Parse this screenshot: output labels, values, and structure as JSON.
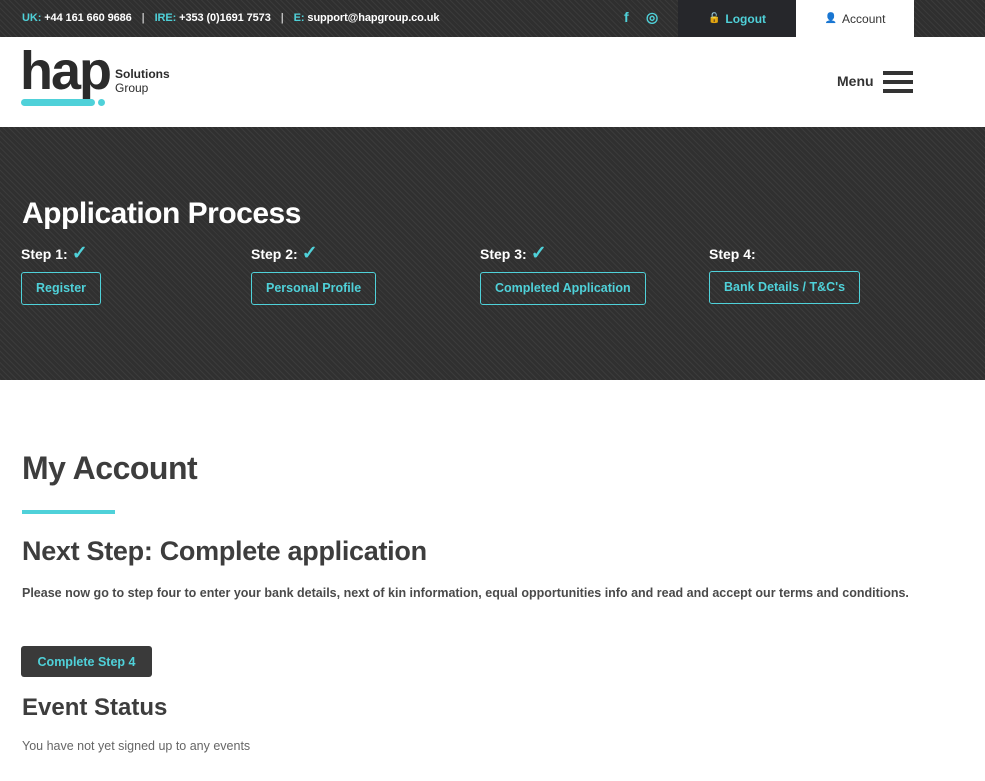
{
  "topbar": {
    "uk_label": "UK:",
    "uk_phone": "+44 161 660 9686",
    "ire_label": "IRE:",
    "ire_phone": "+353 (0)1691 7573",
    "email_label": "E:",
    "email": "support@hapgroup.co.uk",
    "separator": "|",
    "facebook_icon": "f",
    "instagram_icon": "◎",
    "logout_icon": "🔓",
    "logout_label": "Logout",
    "account_icon": "👤",
    "account_label": "Account"
  },
  "header": {
    "logo_word": "hap",
    "logo_line1": "Solutions",
    "logo_line2": "Group",
    "menu_label": "Menu"
  },
  "hero": {
    "title": "Application Process",
    "steps": [
      {
        "label": "Step 1:",
        "check": "✓",
        "button": "Register"
      },
      {
        "label": "Step 2:",
        "check": "✓",
        "button": "Personal Profile"
      },
      {
        "label": "Step 3:",
        "check": "✓",
        "button": "Completed Application"
      },
      {
        "label": "Step 4:",
        "check": "",
        "button": "Bank Details / T&C's"
      }
    ]
  },
  "main": {
    "title": "My Account",
    "next_step_title": "Next Step: Complete application",
    "next_step_desc": "Please now go to step four to enter your bank details, next of kin information, equal opportunities info and read and accept our terms and conditions.",
    "cta_label": "Complete Step 4",
    "event_title": "Event Status",
    "event_desc": "You have not yet signed up to any events"
  },
  "colors": {
    "accent": "#4fd1d9",
    "dark": "#333333",
    "text": "#3d3d3d"
  }
}
